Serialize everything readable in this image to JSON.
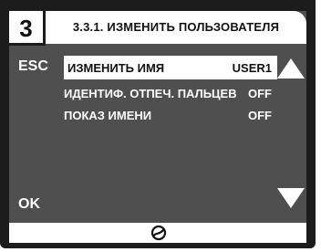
{
  "screen": {
    "number": "3",
    "title": "3.3.1. ИЗМЕНИТЬ ПОЛЬЗОВАТЕЛЯ"
  },
  "softkeys": {
    "esc_label": "ESC",
    "ok_label": "OK"
  },
  "menu": {
    "items": [
      {
        "label": "ИЗМЕНИТЬ ИМЯ",
        "value": "USER1",
        "selected": true
      },
      {
        "label": "ИДЕНТИФ. ОТПЕЧ. ПАЛЬЦЕВ",
        "value": "OFF",
        "selected": false
      },
      {
        "label": "ПОКАЗ ИМЕНИ",
        "value": "OFF",
        "selected": false
      }
    ]
  },
  "icons": {
    "scroll_up": "arrow-up-icon",
    "scroll_down": "arrow-down-icon",
    "status": "bus-connection-icon"
  },
  "colors": {
    "bezel": "#1c1c1c",
    "screen_bg": "#4f4f4f",
    "highlight": "#ffffff",
    "text_dark": "#111111",
    "text_light": "#ffffff"
  }
}
